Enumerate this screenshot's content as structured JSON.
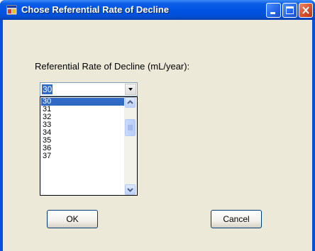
{
  "window": {
    "title": "Chose Referential Rate of Decline",
    "icon": "app-window-icon",
    "controls": [
      "minimize-icon",
      "maximize-icon",
      "close-icon"
    ]
  },
  "form": {
    "label": "Referential Rate of Decline (mL/year):",
    "combo": {
      "selected_value": "30",
      "options": [
        "30",
        "31",
        "32",
        "33",
        "34",
        "35",
        "36",
        "37"
      ],
      "selected_index": 0
    },
    "ok_label": "OK",
    "cancel_label": "Cancel"
  },
  "colors": {
    "titlebar": "#0054e3",
    "face": "#ece9d8",
    "selection": "#316ac5"
  }
}
